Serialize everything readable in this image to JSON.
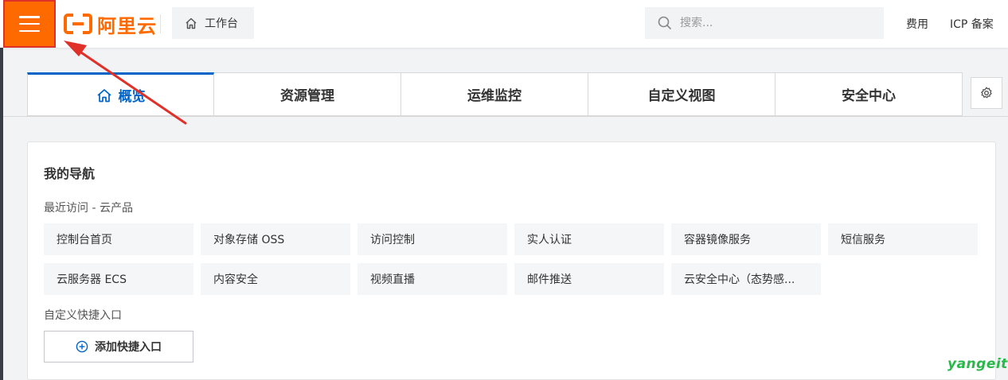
{
  "header": {
    "menu_icon": "hamburger-menu-icon",
    "logo_text": "阿里云",
    "workbench_label": "工作台",
    "search_placeholder": "搜索...",
    "links": [
      "费用",
      "ICP 备案"
    ]
  },
  "tabs": [
    {
      "label": "概览",
      "icon": "home-icon",
      "active": true
    },
    {
      "label": "资源管理",
      "active": false
    },
    {
      "label": "运维监控",
      "active": false
    },
    {
      "label": "自定义视图",
      "active": false
    },
    {
      "label": "安全中心",
      "active": false
    }
  ],
  "nav": {
    "title": "我的导航",
    "recent_label": "最近访问 - 云产品",
    "recent_items": [
      "控制台首页",
      "对象存储 OSS",
      "访问控制",
      "实人认证",
      "容器镜像服务",
      "短信服务",
      "云服务器 ECS",
      "内容安全",
      "视频直播",
      "邮件推送",
      "云安全中心（态势感..."
    ],
    "custom_label": "自定义快捷入口",
    "add_label": "添加快捷入口"
  },
  "watermark": "yangeit",
  "colors": {
    "brand_orange": "#ff6a00",
    "active_blue": "#0064c8",
    "arrow_red": "#e0302a",
    "watermark_green": "#29b84a"
  }
}
